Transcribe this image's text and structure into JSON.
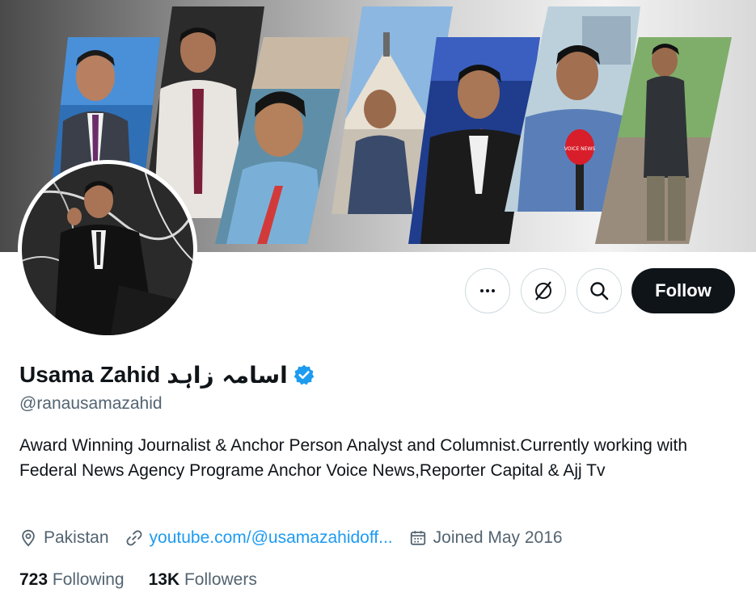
{
  "profile": {
    "name_latin": "Usama Zahid",
    "name_urdu": "اسامہ زاہد",
    "handle": "@ranausamazahid",
    "bio": "Award Winning Journalist & Anchor Person Analyst and Columnist.Currently working with Federal News Agency Programe Anchor Voice News,Reporter Capital & Ajj Tv",
    "location": "Pakistan",
    "website": "youtube.com/@usamazahidoff...",
    "joined": "Joined May 2016"
  },
  "actions": {
    "follow_label": "Follow"
  },
  "stats": {
    "following_count": "723",
    "following_label": "Following",
    "followers_count": "13K",
    "followers_label": "Followers"
  },
  "banner": {
    "mic_label": "VOICE NEWS"
  },
  "colors": {
    "accent": "#1d9bf0",
    "follow_bg": "#0f1419",
    "secondary_text": "#536471",
    "border": "#cfd9de"
  },
  "icons": {
    "more": "more-horizontal-icon",
    "grok": "grok-icon",
    "search": "search-icon",
    "verified": "verified-badge-icon",
    "location": "location-pin-icon",
    "link": "link-icon",
    "calendar": "calendar-icon"
  }
}
